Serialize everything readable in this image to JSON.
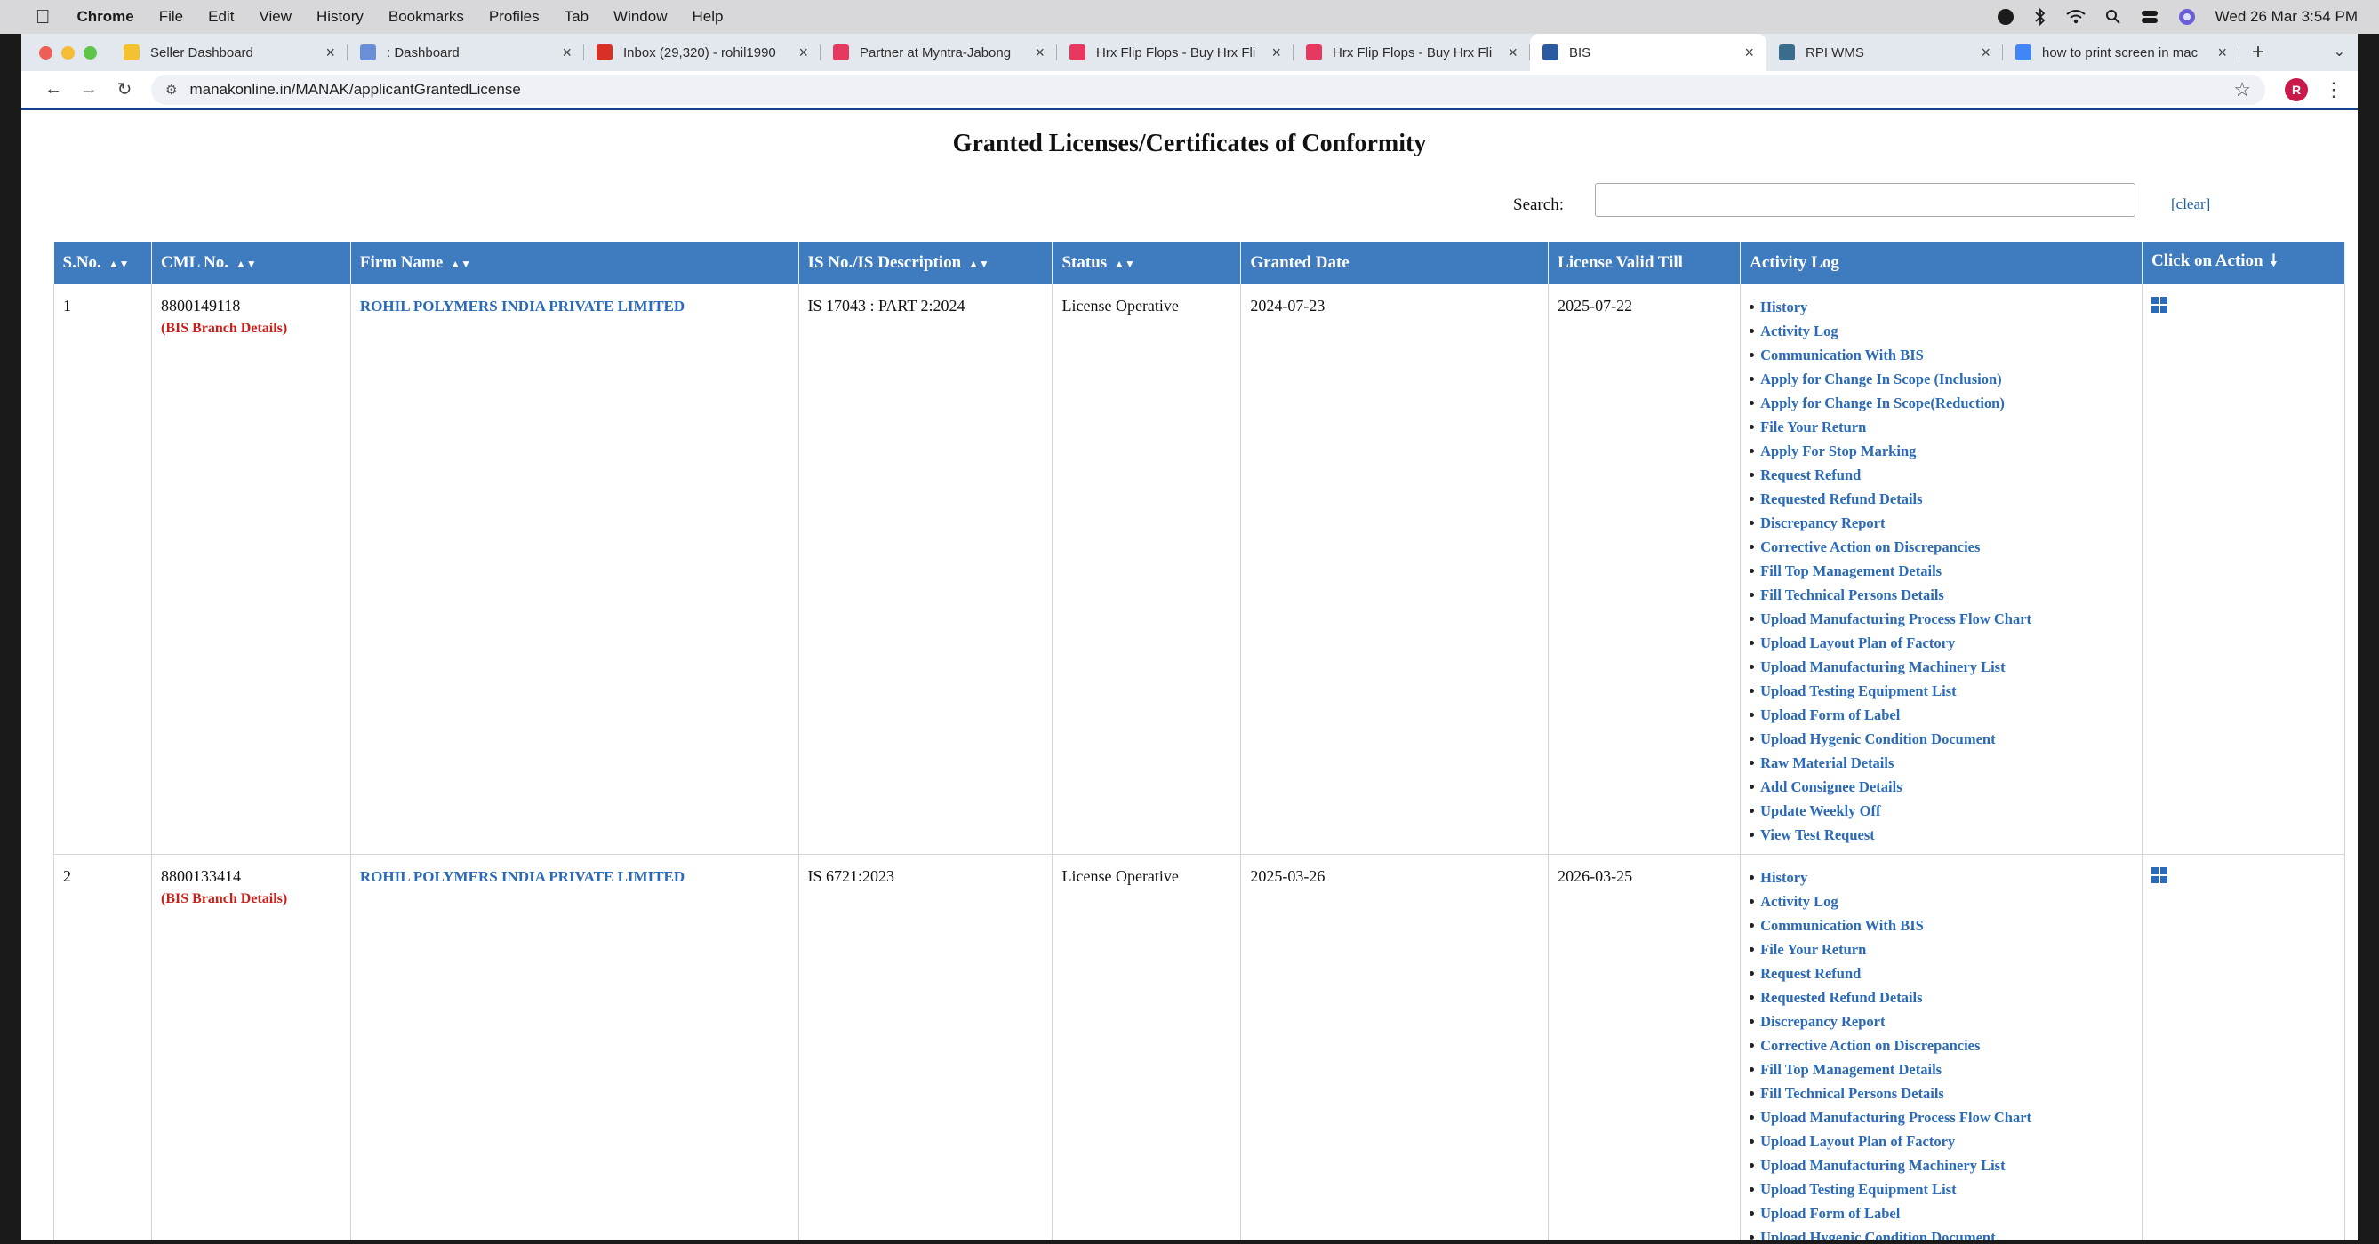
{
  "menubar": {
    "app": "Chrome",
    "items": [
      "File",
      "Edit",
      "View",
      "History",
      "Bookmarks",
      "Profiles",
      "Tab",
      "Window",
      "Help"
    ],
    "clock": "Wed 26 Mar  3:54 PM"
  },
  "tabs": [
    {
      "title": "Seller Dashboard",
      "icon": "seller-icon",
      "color": "#f2c230"
    },
    {
      "title": ": Dashboard",
      "icon": "om-icon",
      "color": "#6a8fd8"
    },
    {
      "title": "Inbox (29,320) - rohil1990",
      "icon": "gmail-icon",
      "color": "#d93025"
    },
    {
      "title": "Partner at Myntra-Jabong",
      "icon": "myntra-icon",
      "color": "#e7385f"
    },
    {
      "title": "Hrx Flip Flops - Buy Hrx Fli",
      "icon": "myntra-icon",
      "color": "#e7385f"
    },
    {
      "title": "Hrx Flip Flops - Buy Hrx Fli",
      "icon": "myntra-icon",
      "color": "#e7385f"
    },
    {
      "title": "BIS",
      "icon": "bis-icon",
      "color": "#2c5aa0",
      "active": true
    },
    {
      "title": "RPI WMS",
      "icon": "wms-icon",
      "color": "#3a6d8c"
    },
    {
      "title": "how to print screen in mac",
      "icon": "google-icon",
      "color": "#4285f4"
    }
  ],
  "address": {
    "url": "manakonline.in/MANAK/applicantGrantedLicense",
    "avatar_letter": "R"
  },
  "page": {
    "title": "Granted Licenses/Certificates of Conformity",
    "search_label": "Search:",
    "search_value": "",
    "clear_label": "[clear]"
  },
  "table": {
    "headers": [
      "S.No.",
      "CML No.",
      "Firm Name",
      "IS No./IS Description",
      "Status",
      "Granted Date",
      "License Valid Till",
      "Activity Log",
      "Click on Action"
    ],
    "rows": [
      {
        "sno": "1",
        "cml": "8800149118",
        "branch": "(BIS Branch Details)",
        "firm": "ROHIL POLYMERS INDIA PRIVATE LIMITED",
        "is_no": "IS 17043 : PART 2:2024",
        "status": "License Operative",
        "granted": "2024-07-23",
        "valid_till": "2025-07-22",
        "activities": [
          "History",
          "Activity Log",
          "Communication With BIS",
          "Apply for Change In Scope (Inclusion)",
          "Apply for Change In Scope(Reduction)",
          "File Your Return",
          "Apply For Stop Marking",
          "Request Refund",
          "Requested Refund Details",
          "Discrepancy Report",
          "Corrective Action on Discrepancies",
          "Fill Top Management Details",
          "Fill Technical Persons Details",
          "Upload Manufacturing Process Flow Chart",
          "Upload Layout Plan of Factory",
          "Upload Manufacturing Machinery List",
          "Upload Testing Equipment List",
          "Upload Form of Label",
          "Upload Hygenic Condition Document",
          "Raw Material Details",
          "Add Consignee Details",
          "Update Weekly Off",
          "View Test Request"
        ]
      },
      {
        "sno": "2",
        "cml": "8800133414",
        "branch": "(BIS Branch Details)",
        "firm": "ROHIL POLYMERS INDIA PRIVATE LIMITED",
        "is_no": "IS 6721:2023",
        "status": "License Operative",
        "granted": "2025-03-26",
        "valid_till": "2026-03-25",
        "activities": [
          "History",
          "Activity Log",
          "Communication With BIS",
          "File Your Return",
          "Request Refund",
          "Requested Refund Details",
          "Discrepancy Report",
          "Corrective Action on Discrepancies",
          "Fill Top Management Details",
          "Fill Technical Persons Details",
          "Upload Manufacturing Process Flow Chart",
          "Upload Layout Plan of Factory",
          "Upload Manufacturing Machinery List",
          "Upload Testing Equipment List",
          "Upload Form of Label",
          "Upload Hygenic Condition Document"
        ]
      }
    ]
  }
}
